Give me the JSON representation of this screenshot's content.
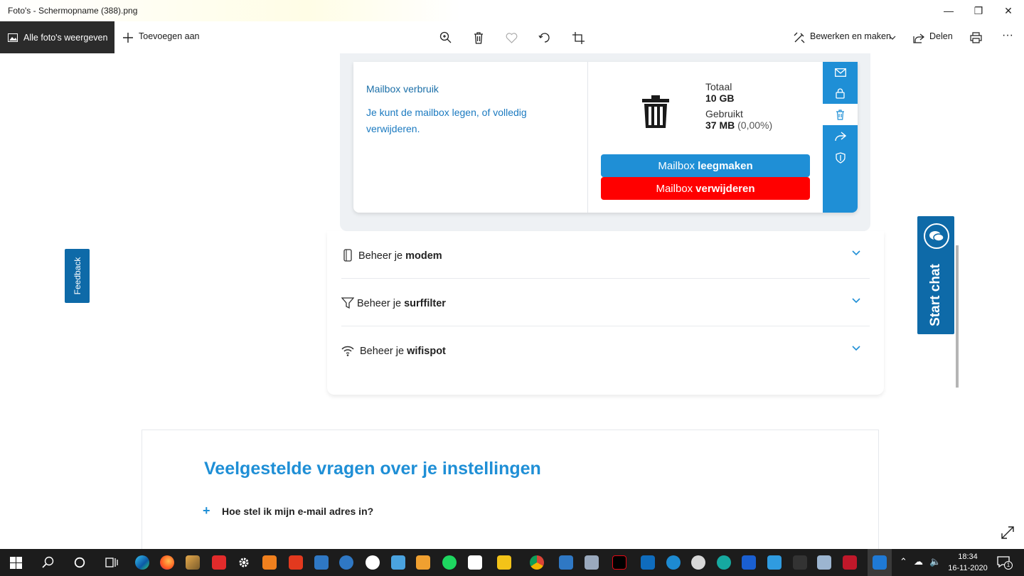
{
  "window": {
    "title": "Foto's - Schermopname (388).png",
    "minimize_glyph": "—",
    "maximize_glyph": "❐",
    "close_glyph": "✕"
  },
  "toolbar": {
    "all_photos_label": "Alle foto's weergeven",
    "add_to_label": "Toevoegen aan",
    "edit_label": "Bewerken en maken",
    "share_label": "Delen",
    "more_glyph": "···",
    "icons": [
      "zoom-icon",
      "delete-icon",
      "heart-icon",
      "rotate-icon",
      "crop-icon",
      "edit-icon",
      "share-icon",
      "print-icon"
    ]
  },
  "mailbox": {
    "title": "Mailbox verbruik",
    "description": "Je kunt de mailbox legen, of volledig verwijderen.",
    "total_label": "Totaal",
    "total_value": "10 GB",
    "used_label": "Gebruikt",
    "used_value": "37 MB",
    "used_percent": "(0,00%)",
    "empty_button_prefix": "Mailbox",
    "empty_button_bold": "leegmaken",
    "delete_button_prefix": "Mailbox",
    "delete_button_bold": "verwijderen",
    "sidebar_icons": [
      "mail-icon",
      "lock-icon",
      "trash-icon",
      "forward-icon",
      "shield-icon"
    ],
    "colors": {
      "blue": "#1f8fd6",
      "red": "#ff0000"
    }
  },
  "accordion": [
    {
      "prefix": "Beheer je",
      "bold": "modem",
      "icon": "modem-icon"
    },
    {
      "prefix": "Beheer je",
      "bold": "surffilter",
      "icon": "filter-icon"
    },
    {
      "prefix": "Beheer je",
      "bold": "wifispot",
      "icon": "wifi-icon"
    }
  ],
  "faq": {
    "title": "Veelgestelde vragen over je instellingen",
    "questions": [
      "Hoe stel ik mijn e-mail adres in?"
    ]
  },
  "feedback_label": "Feedback",
  "start_chat_label": "Start chat",
  "taskbar": {
    "time": "18:34",
    "date": "16-11-2020",
    "notification_count": "1"
  }
}
